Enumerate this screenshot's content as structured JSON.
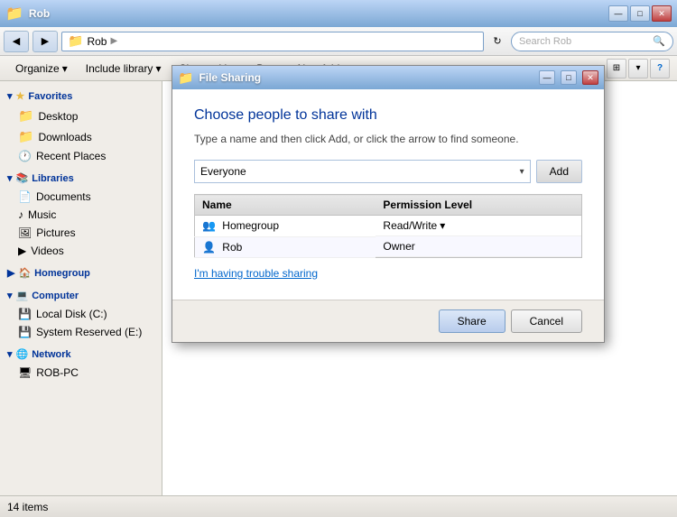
{
  "window": {
    "title": "Rob",
    "controls": {
      "minimize": "—",
      "maximize": "□",
      "close": "✕"
    }
  },
  "addressbar": {
    "path": "Rob",
    "search_placeholder": "Search Rob",
    "nav_back": "◀",
    "nav_forward": "▶",
    "refresh": "↻"
  },
  "toolbar": {
    "organize": "Organize",
    "include_library": "Include library",
    "share_with": "Share with",
    "burn": "Burn",
    "new_folder": "New folder",
    "dropdown_arrow": "▾"
  },
  "sidebar": {
    "favorites_label": "Favorites",
    "items_favorites": [
      {
        "label": "Desktop",
        "icon": "★"
      },
      {
        "label": "Downloads",
        "icon": "📁"
      },
      {
        "label": "Recent Places",
        "icon": "🕐"
      }
    ],
    "libraries_label": "Libraries",
    "items_libraries": [
      {
        "label": "Documents",
        "icon": "📄"
      },
      {
        "label": "Music",
        "icon": "♪"
      },
      {
        "label": "Pictures",
        "icon": "🖼"
      },
      {
        "label": "Videos",
        "icon": "▶"
      }
    ],
    "homegroup_label": "Homegroup",
    "computer_label": "Computer",
    "items_computer": [
      {
        "label": "Local Disk (C:)",
        "icon": "💾"
      },
      {
        "label": "System Reserved (E:)",
        "icon": "💾"
      }
    ],
    "network_label": "Network",
    "items_network": [
      {
        "label": "ROB-PC",
        "icon": "🖥"
      }
    ]
  },
  "statusbar": {
    "item_count": "14 items"
  },
  "dialog": {
    "title": "File Sharing",
    "heading": "Choose people to share with",
    "subtitle": "Type a name and then click Add, or click the arrow to find someone.",
    "dropdown_value": "Everyone",
    "add_button": "Add",
    "table": {
      "col_name": "Name",
      "col_permission": "Permission Level",
      "rows": [
        {
          "name": "Homegroup",
          "permission": "Read/Write",
          "has_dropdown": true,
          "type": "group"
        },
        {
          "name": "Rob",
          "permission": "Owner",
          "has_dropdown": false,
          "type": "user"
        }
      ]
    },
    "trouble_link": "I'm having trouble sharing",
    "share_button": "Share",
    "cancel_button": "Cancel",
    "min_btn": "—",
    "max_btn": "□",
    "close_btn": "✕"
  }
}
